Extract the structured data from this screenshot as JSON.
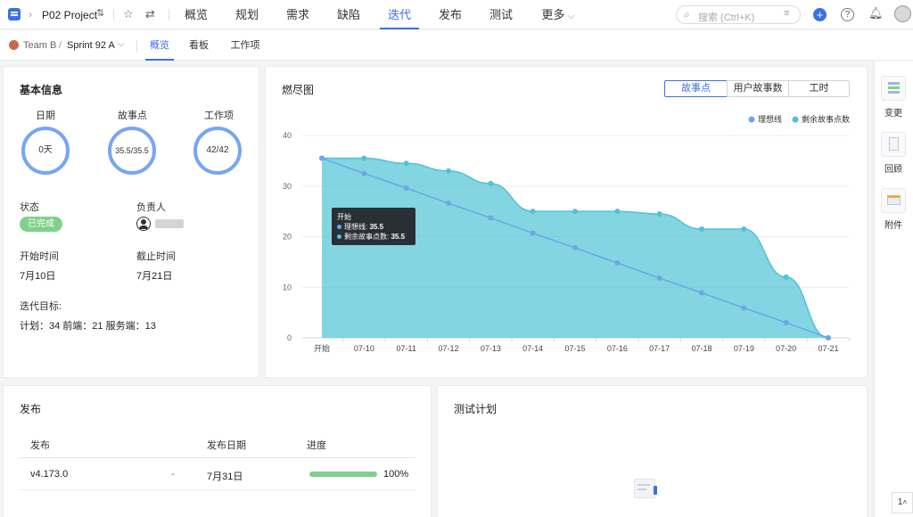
{
  "topbar": {
    "project_name": "P02 Project",
    "tabs": [
      {
        "label": "概览"
      },
      {
        "label": "规划"
      },
      {
        "label": "需求"
      },
      {
        "label": "缺陷"
      },
      {
        "label": "迭代"
      },
      {
        "label": "发布"
      },
      {
        "label": "测试"
      },
      {
        "label": "更多"
      }
    ],
    "active_tab": "迭代",
    "search_placeholder": "搜索 (Ctrl+K)"
  },
  "subbar": {
    "team": "Team B",
    "separator": "/",
    "sprint": "Sprint 92 A",
    "tabs": [
      {
        "label": "概览"
      },
      {
        "label": "看板"
      },
      {
        "label": "工作项"
      }
    ],
    "active_tab": "概览"
  },
  "basic_info": {
    "title": "基本信息",
    "metrics": [
      {
        "label": "日期",
        "value": "0天"
      },
      {
        "label": "故事点",
        "value": "35.5/35.5"
      },
      {
        "label": "工作项",
        "value": "42/42"
      }
    ],
    "status_label": "状态",
    "status_value": "已完成",
    "owner_label": "负责人",
    "start_label": "开始时间",
    "start_value": "7月10日",
    "end_label": "截止时间",
    "end_value": "7月21日",
    "goal_label": "迭代目标:",
    "goal_value": "计划：34 前端：21 服务端：13"
  },
  "burndown": {
    "title": "燃尽图",
    "segments": [
      "故事点",
      "用户故事数",
      "工时"
    ],
    "active_segment": "故事点",
    "tooltip": {
      "title": "开始",
      "line1_label": "理想线: ",
      "line1_value": "35.5",
      "line2_label": "剩余故事点数: ",
      "line2_value": "35.5"
    }
  },
  "chart_data": {
    "type": "area",
    "title": "燃尽图",
    "categories": [
      "开始",
      "07-10",
      "07-11",
      "07-12",
      "07-13",
      "07-14",
      "07-15",
      "07-16",
      "07-17",
      "07-18",
      "07-19",
      "07-20",
      "07-21"
    ],
    "series": [
      {
        "name": "理想线",
        "color": "#6aa8e8",
        "values": [
          35.5,
          32.5,
          29.6,
          26.6,
          23.7,
          20.7,
          17.8,
          14.8,
          11.8,
          8.9,
          5.9,
          3.0,
          0
        ]
      },
      {
        "name": "剩余故事点数",
        "color": "#4fc3d6",
        "values": [
          35.5,
          35.5,
          34.5,
          33,
          30.5,
          25,
          25,
          25,
          24.5,
          21.5,
          21.5,
          12,
          0
        ]
      }
    ],
    "ylim": [
      0,
      40
    ],
    "yticks": [
      0,
      10,
      20,
      30,
      40
    ],
    "grid": true,
    "legend_position": "top-right"
  },
  "release": {
    "title": "发布",
    "headers": [
      "发布",
      "发布日期",
      "进度"
    ],
    "rows": [
      {
        "name": "v4.173.0",
        "dash": "-",
        "date": "7月31日",
        "progress": 1.0,
        "progress_text": "100%"
      }
    ]
  },
  "testplan": {
    "title": "测试计划"
  },
  "side": {
    "items": [
      {
        "label": "变更"
      },
      {
        "label": "回顾"
      },
      {
        "label": "附件"
      }
    ],
    "counter": "1"
  },
  "colors": {
    "accent": "#3d6fe8",
    "ring": "#76a6f3",
    "status_green": "#7fd08a",
    "progress_green": "#7fd08a"
  }
}
